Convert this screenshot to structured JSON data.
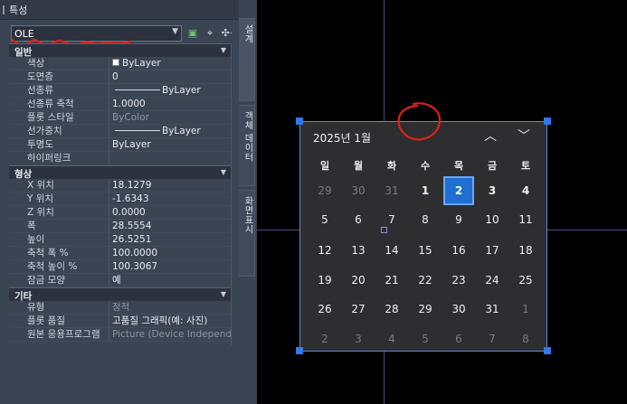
{
  "palette": {
    "title": "특성",
    "object_select": "OLE",
    "side_tabs": [
      "설계",
      "객체 데이터",
      "화면표시"
    ]
  },
  "sections": [
    {
      "name": "일반",
      "rows": [
        {
          "key": "색상",
          "value": "ByLayer",
          "swatch": "#ffffff"
        },
        {
          "key": "도면층",
          "value": "0"
        },
        {
          "key": "선종류",
          "value": "ByLayer",
          "line": true
        },
        {
          "key": "선종류 축척",
          "value": "1.0000"
        },
        {
          "key": "플롯 스타일",
          "value": "ByColor",
          "dim": true
        },
        {
          "key": "선가중치",
          "value": "ByLayer",
          "line": true
        },
        {
          "key": "투명도",
          "value": "ByLayer"
        },
        {
          "key": "하이퍼링크",
          "value": ""
        }
      ]
    },
    {
      "name": "형상",
      "rows": [
        {
          "key": "X 위치",
          "value": "18.1279"
        },
        {
          "key": "Y 위치",
          "value": "-1.6343"
        },
        {
          "key": "Z 위치",
          "value": "0.0000"
        },
        {
          "key": "폭",
          "value": "28.5554"
        },
        {
          "key": "높이",
          "value": "26.5251"
        },
        {
          "key": "축척 폭 %",
          "value": "100.0000"
        },
        {
          "key": "축척 높이 %",
          "value": "100.3067"
        },
        {
          "key": "잠금 모양",
          "value": "예"
        }
      ]
    },
    {
      "name": "기타",
      "rows": [
        {
          "key": "유형",
          "value": "정적",
          "dim": true
        },
        {
          "key": "플롯 품질",
          "value": "고품질 그래픽(예: 사진)"
        },
        {
          "key": "원본 응용프로그램",
          "value": "Picture (Device Independent...",
          "dim": true
        }
      ]
    }
  ],
  "calendar": {
    "month_label": "2025년 1월",
    "weekdays": [
      "일",
      "월",
      "화",
      "수",
      "목",
      "금",
      "토"
    ],
    "weeks": [
      [
        "29",
        "30",
        "31",
        "1",
        "2",
        "3",
        "4"
      ],
      [
        "5",
        "6",
        "7",
        "8",
        "9",
        "10",
        "11"
      ],
      [
        "12",
        "13",
        "14",
        "15",
        "16",
        "17",
        "18"
      ],
      [
        "19",
        "20",
        "21",
        "22",
        "23",
        "24",
        "25"
      ],
      [
        "26",
        "27",
        "28",
        "29",
        "30",
        "31",
        "1"
      ],
      [
        "2",
        "3",
        "4",
        "5",
        "6",
        "7",
        "8"
      ]
    ],
    "selected_day": "2",
    "icons": {
      "prev": "chevron-up-icon",
      "next": "chevron-down-icon"
    }
  },
  "colors": {
    "palette_bg": "#3b4453",
    "selection_grip": "#2f79e8",
    "today_fill": "#1f6fd1",
    "annotation": "#e0201a"
  }
}
